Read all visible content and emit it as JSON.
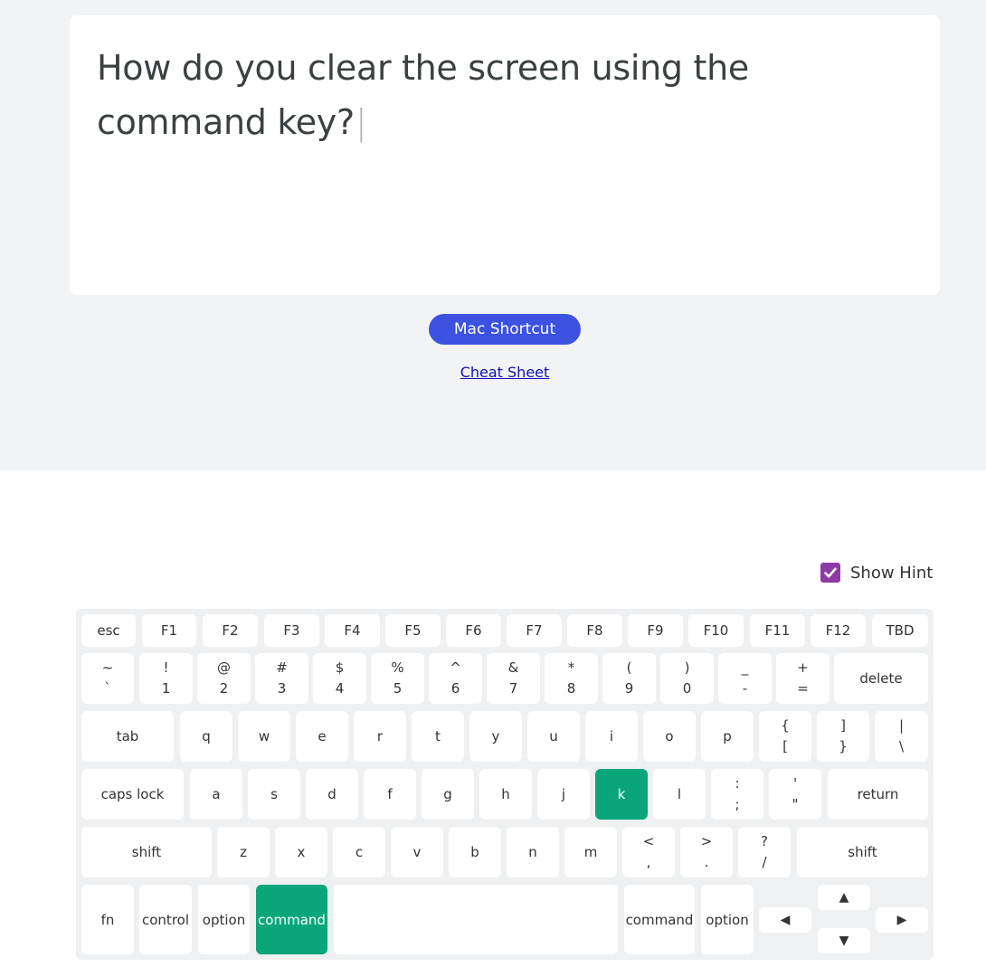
{
  "question": {
    "text": "How do you clear the screen using the command key?"
  },
  "mac_button": {
    "label": "Mac Shortcut"
  },
  "cheat_sheet": {
    "label": "Cheat Sheet"
  },
  "hint": {
    "label": "Show Hint",
    "checked": true
  },
  "colors": {
    "accent_button": "#3d52e0",
    "active_key": "#0aa679",
    "hint_checkbox": "#8e3aa6",
    "link": "#1010b0"
  },
  "keyboard": {
    "rows": [
      [
        {
          "label": "esc"
        },
        {
          "label": "F1"
        },
        {
          "label": "F2"
        },
        {
          "label": "F3"
        },
        {
          "label": "F4"
        },
        {
          "label": "F5"
        },
        {
          "label": "F6"
        },
        {
          "label": "F7"
        },
        {
          "label": "F8"
        },
        {
          "label": "F9"
        },
        {
          "label": "F10"
        },
        {
          "label": "F11"
        },
        {
          "label": "F12"
        },
        {
          "label": "TBD"
        }
      ],
      [
        {
          "top": "~",
          "bottom": "`"
        },
        {
          "top": "!",
          "bottom": "1"
        },
        {
          "top": "@",
          "bottom": "2"
        },
        {
          "top": "#",
          "bottom": "3"
        },
        {
          "top": "$",
          "bottom": "4"
        },
        {
          "top": "%",
          "bottom": "5"
        },
        {
          "top": "^",
          "bottom": "6"
        },
        {
          "top": "&",
          "bottom": "7"
        },
        {
          "top": "*",
          "bottom": "8"
        },
        {
          "top": "(",
          "bottom": "9"
        },
        {
          "top": ")",
          "bottom": "0"
        },
        {
          "top": "_",
          "bottom": "-"
        },
        {
          "top": "+",
          "bottom": "="
        },
        {
          "label": "delete"
        }
      ],
      [
        {
          "label": "tab"
        },
        {
          "label": "q"
        },
        {
          "label": "w"
        },
        {
          "label": "e"
        },
        {
          "label": "r"
        },
        {
          "label": "t"
        },
        {
          "label": "y"
        },
        {
          "label": "u"
        },
        {
          "label": "i"
        },
        {
          "label": "o"
        },
        {
          "label": "p"
        },
        {
          "top": "{",
          "bottom": "["
        },
        {
          "top": "]",
          "bottom": "}"
        },
        {
          "top": "|",
          "bottom": "\\"
        }
      ],
      [
        {
          "label": "caps lock"
        },
        {
          "label": "a"
        },
        {
          "label": "s"
        },
        {
          "label": "d"
        },
        {
          "label": "f"
        },
        {
          "label": "g"
        },
        {
          "label": "h"
        },
        {
          "label": "j"
        },
        {
          "label": "k",
          "active": true
        },
        {
          "label": "l"
        },
        {
          "top": ":",
          "bottom": ";"
        },
        {
          "top": "'",
          "bottom": "\""
        },
        {
          "label": "return"
        }
      ],
      [
        {
          "label": "shift"
        },
        {
          "label": "z"
        },
        {
          "label": "x"
        },
        {
          "label": "c"
        },
        {
          "label": "v"
        },
        {
          "label": "b"
        },
        {
          "label": "n"
        },
        {
          "label": "m"
        },
        {
          "top": "<",
          "bottom": ","
        },
        {
          "top": ">",
          "bottom": "."
        },
        {
          "top": "?",
          "bottom": "/"
        },
        {
          "label": "shift"
        }
      ],
      [
        {
          "label": "fn"
        },
        {
          "label": "control"
        },
        {
          "label": "option"
        },
        {
          "label": "command",
          "active": true
        },
        {
          "label": ""
        },
        {
          "label": "command"
        },
        {
          "label": "option"
        },
        {
          "label": "◀",
          "icon": "arrow-left-icon"
        },
        {
          "label": "▲",
          "icon": "arrow-up-icon"
        },
        {
          "label": "▼",
          "icon": "arrow-down-icon"
        },
        {
          "label": "▶",
          "icon": "arrow-right-icon"
        }
      ]
    ]
  }
}
